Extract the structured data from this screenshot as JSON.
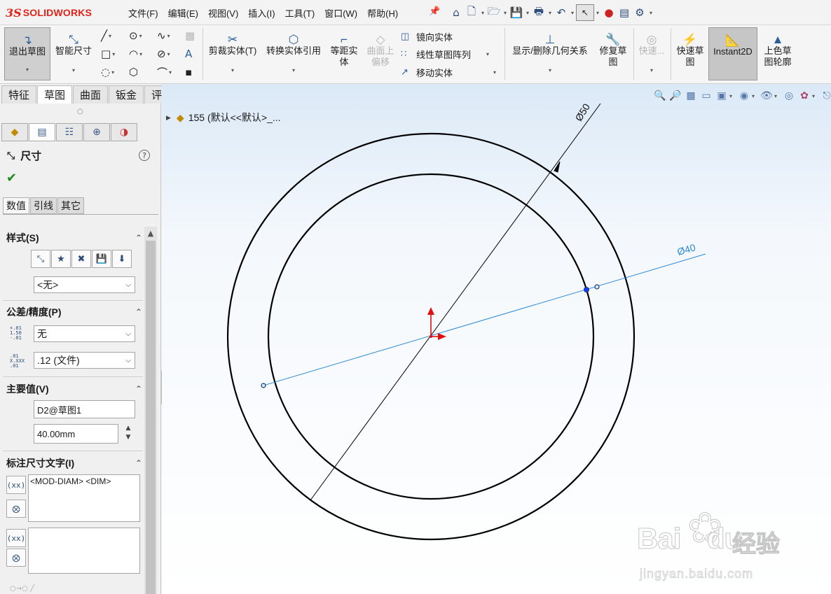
{
  "app": {
    "logo_ds": "3S",
    "logo_text": "SOLIDWORKS"
  },
  "menu": [
    "文件(F)",
    "编辑(E)",
    "视图(V)",
    "插入(I)",
    "工具(T)",
    "窗口(W)",
    "帮助(H)"
  ],
  "ribbon": {
    "exit_sketch": "退出草图",
    "smart_dimension": "智能尺寸",
    "trim_entities": "剪裁实体(T)",
    "convert_entities": "转换实体引用",
    "offset_entities_line1": "等距实",
    "offset_entities_line2": "体",
    "offset_surface_line1": "曲面上",
    "offset_surface_line2": "偏移",
    "mirror_entities": "镜向实体",
    "linear_pattern": "线性草图阵列",
    "move_entities": "移动实体",
    "display_relations": "显示/删除几何关系",
    "repair_sketch_line1": "修复草",
    "repair_sketch_line2": "图",
    "quick_snaps": "快速...",
    "rapid_sketch_line1": "快速草",
    "rapid_sketch_line2": "图",
    "instant2d": "Instant2D",
    "shaded_contours_line1": "上色草",
    "shaded_contours_line2": "图轮廓"
  },
  "tabs": [
    "特征",
    "草图",
    "曲面",
    "钣金",
    "评估"
  ],
  "active_tab": "草图",
  "property_manager": {
    "title": "尺寸",
    "help": "?",
    "subtabs": [
      "数值",
      "引线",
      "其它"
    ],
    "style": {
      "header": "样式(S)",
      "selected": "<无>"
    },
    "tolerance": {
      "header": "公差/精度(P)",
      "tolerance_type": "无",
      "precision": ".12 (文件)",
      "tol_icon": "±.01 / 1.50 / -.01",
      "prec_icon": ".01 / X.XXX / .01"
    },
    "primary_value": {
      "header": "主要值(V)",
      "name": "D2@草图1",
      "value": "40.00mm"
    },
    "dimension_text": {
      "header": "标注尺寸文字(I)",
      "text": "<MOD-DIAM> <DIM>"
    }
  },
  "feature_tree": {
    "root": "155  (默认<<默认>_..."
  },
  "dimensions": {
    "outer": "Ø50",
    "inner": "Ø40"
  },
  "watermark": {
    "brand": "Bai",
    "brand_du": "du",
    "jingyan": "经验",
    "url": "jingyan.baidu.com"
  },
  "colors": {
    "sketch": "#000000",
    "selected_dim": "#2a8ad6",
    "origin_x": "#e01010",
    "origin_y": "#e01010"
  }
}
